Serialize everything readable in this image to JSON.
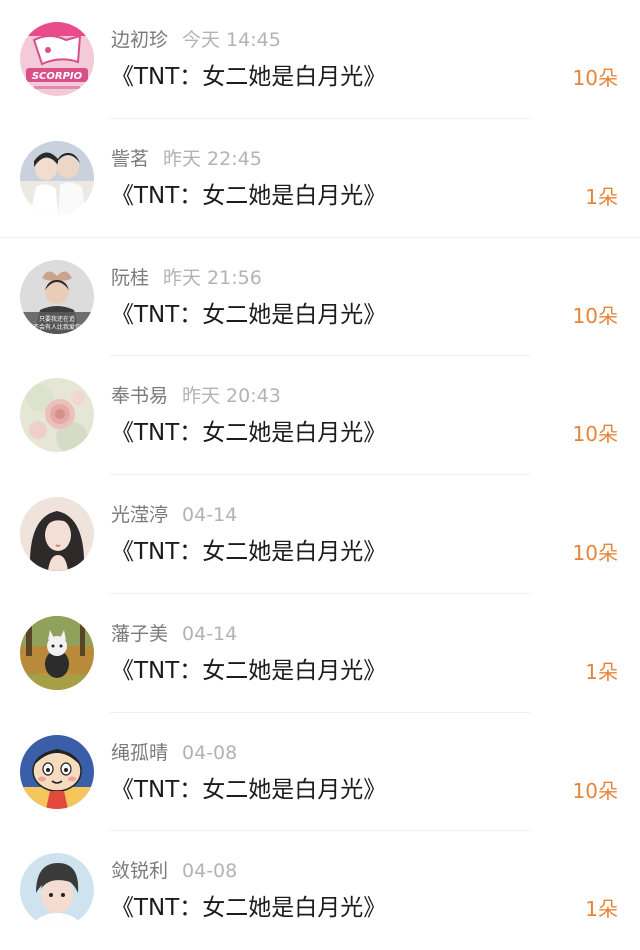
{
  "entries": [
    {
      "name": "边初珍",
      "time": "今天 14:45",
      "title": "《TNT：女二她是白月光》",
      "count": "10朵",
      "avatar": "scorpio-cartoon-avatar",
      "avatar_colors": [
        "#f4c9d8",
        "#d94f8a"
      ],
      "avatar_text": "SCORPIO"
    },
    {
      "name": "訾茗",
      "time": "昨天 22:45",
      "title": "《TNT：女二她是白月光》",
      "count": "1朵",
      "avatar": "couple-photo-avatar",
      "avatar_colors": [
        "#c9d2dc",
        "#ece8e3"
      ]
    },
    {
      "name": "阮桂",
      "time": "昨天 21:56",
      "title": "《TNT：女二她是白月光》",
      "count": "10朵",
      "avatar": "heart-gesture-photo-avatar",
      "avatar_colors": [
        "#dcdcdc",
        "#6a6a6a"
      ],
      "avatar_caption": [
        "只要我还在追",
        "不会有人比我爱你"
      ]
    },
    {
      "name": "奉书易",
      "time": "昨天 20:43",
      "title": "《TNT：女二她是白月光》",
      "count": "10朵",
      "avatar": "rose-flower-avatar",
      "avatar_colors": [
        "#e6e6d6",
        "#ecc1bd"
      ]
    },
    {
      "name": "光滢渟",
      "time": "04-14",
      "title": "《TNT：女二她是白月光》",
      "count": "10朵",
      "avatar": "girl-portrait-avatar",
      "avatar_colors": [
        "#2e2a2a",
        "#efe3dc"
      ]
    },
    {
      "name": "藩子美",
      "time": "04-14",
      "title": "《TNT：女二她是白月光》",
      "count": "1朵",
      "avatar": "cat-autumn-avatar",
      "avatar_colors": [
        "#b98a3a",
        "#7fae58"
      ]
    },
    {
      "name": "绳孤晴",
      "time": "04-08",
      "title": "《TNT：女二她是白月光》",
      "count": "10朵",
      "avatar": "cartoon-boy-avatar",
      "avatar_colors": [
        "#f4c65c",
        "#3a5ea8"
      ]
    },
    {
      "name": "敛锐利",
      "time": "04-08",
      "title": "《TNT：女二她是白月光》",
      "count": "1朵",
      "avatar": "child-photo-avatar",
      "avatar_colors": [
        "#cfe3ee",
        "#3a3a3a"
      ]
    }
  ]
}
